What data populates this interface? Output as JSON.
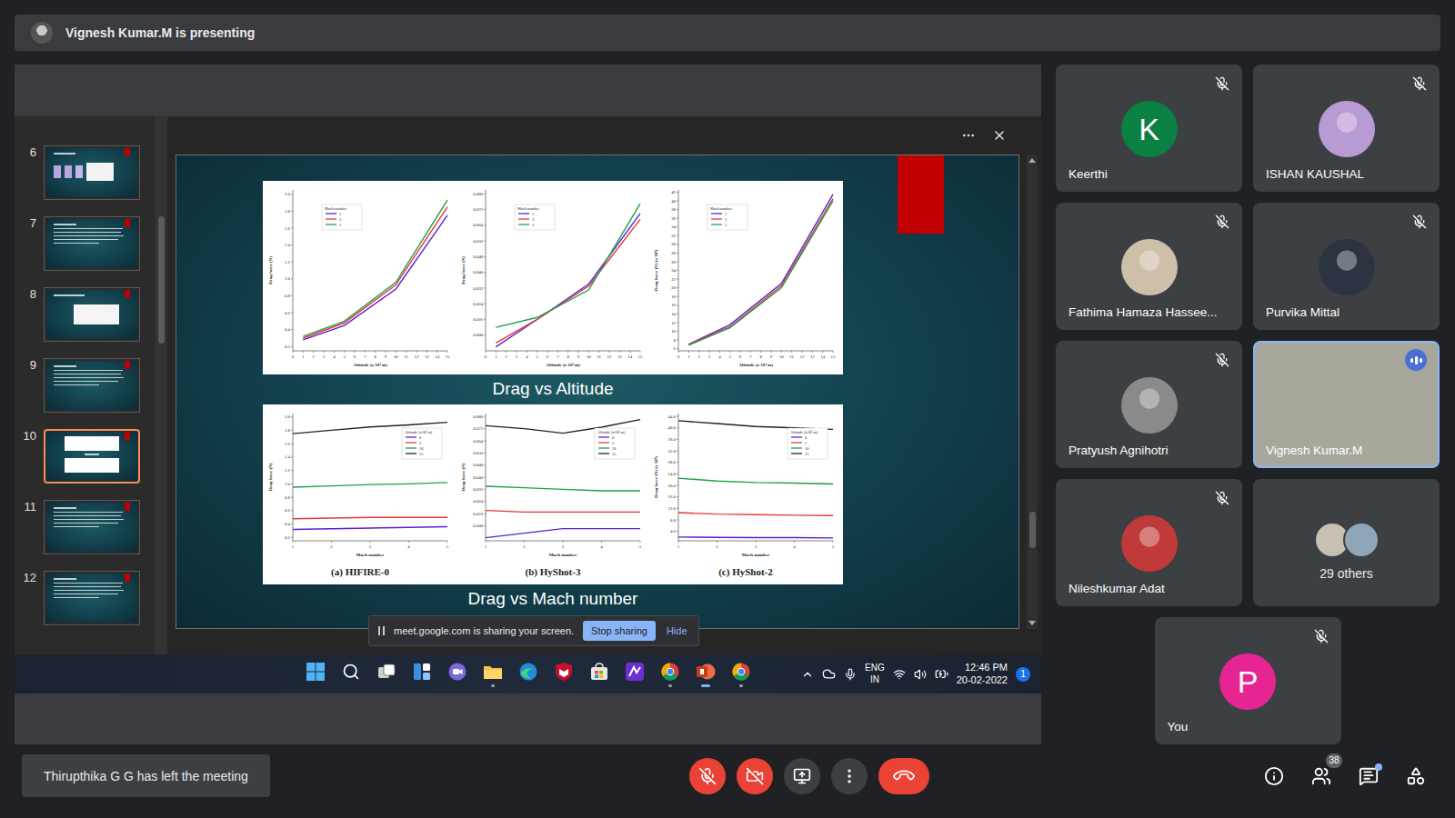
{
  "banner": {
    "text": "Vignesh Kumar.M is presenting"
  },
  "presentation": {
    "thumbnails": [
      {
        "number": "6",
        "selected": false,
        "kind": "images"
      },
      {
        "number": "7",
        "selected": false,
        "kind": "text"
      },
      {
        "number": "8",
        "selected": false,
        "kind": "table"
      },
      {
        "number": "9",
        "selected": false,
        "kind": "text"
      },
      {
        "number": "10",
        "selected": true,
        "kind": "charts"
      },
      {
        "number": "11",
        "selected": false,
        "kind": "text"
      },
      {
        "number": "12",
        "selected": false,
        "kind": "text"
      }
    ],
    "slide": {
      "sections": [
        {
          "title": "Drag vs Altitude",
          "charts": [
            {
              "caption": "",
              "y_label": "Drag force (N)",
              "x_label": "Altitude (x 10³ m)",
              "legend_title": "Mach number",
              "x_ticks": [
                "0",
                "1",
                "2",
                "3",
                "4",
                "5",
                "6",
                "7",
                "8",
                "9",
                "10",
                "11",
                "12",
                "13",
                "14",
                "15"
              ],
              "y_ticks": [
                "0.2",
                "0.4",
                "0.6",
                "0.8",
                "1.0",
                "1.2",
                "1.4",
                "1.6",
                "1.8",
                "2.0"
              ],
              "x": [
                1,
                5,
                10,
                15
              ],
              "series": [
                {
                  "name": "1",
                  "color": "#5b1fd6",
                  "values": [
                    0.28,
                    0.45,
                    0.88,
                    1.75
                  ]
                },
                {
                  "name": "3",
                  "color": "#e53935",
                  "values": [
                    0.3,
                    0.48,
                    0.93,
                    1.85
                  ]
                },
                {
                  "name": "5",
                  "color": "#1e9e4a",
                  "values": [
                    0.32,
                    0.5,
                    0.96,
                    1.93
                  ]
                }
              ]
            },
            {
              "caption": "",
              "y_label": "Drag force (N)",
              "x_label": "Altitude (x 10³ m)",
              "legend_title": "Mach number",
              "x_ticks": [
                "0",
                "1",
                "2",
                "3",
                "4",
                "5",
                "6",
                "7",
                "8",
                "9",
                "10",
                "11",
                "12",
                "13",
                "14",
                "15"
              ],
              "y_ticks": [
                "0.008",
                "0.016",
                "0.024",
                "0.032",
                "0.040",
                "0.048",
                "0.056",
                "0.064",
                "0.072",
                "0.080"
              ],
              "x": [
                1,
                5,
                10,
                15
              ],
              "series": [
                {
                  "name": "1",
                  "color": "#5b1fd6",
                  "values": [
                    0.002,
                    0.016,
                    0.034,
                    0.07
                  ]
                },
                {
                  "name": "3",
                  "color": "#e53935",
                  "values": [
                    0.004,
                    0.016,
                    0.033,
                    0.067
                  ]
                },
                {
                  "name": "5",
                  "color": "#1e9e4a",
                  "values": [
                    0.012,
                    0.017,
                    0.031,
                    0.075
                  ]
                }
              ]
            },
            {
              "caption": "",
              "y_label": "Drag force (N) (x 10³)",
              "x_label": "Altitude (x 10³ m)",
              "legend_title": "Mach number",
              "x_ticks": [
                "0",
                "1",
                "2",
                "3",
                "4",
                "5",
                "6",
                "7",
                "8",
                "9",
                "10",
                "11",
                "12",
                "13",
                "14",
                "15"
              ],
              "y_ticks": [
                "6",
                "8",
                "10",
                "12",
                "14",
                "16",
                "18",
                "20",
                "22",
                "24",
                "26",
                "28",
                "30",
                "32",
                "34",
                "36",
                "38",
                "40",
                "42"
              ],
              "x": [
                1,
                5,
                10,
                15
              ],
              "series": [
                {
                  "name": "1",
                  "color": "#5b1fd6",
                  "values": [
                    7,
                    11.5,
                    21,
                    41.5
                  ]
                },
                {
                  "name": "3",
                  "color": "#e53935",
                  "values": [
                    7,
                    11,
                    20.5,
                    40.5
                  ]
                },
                {
                  "name": "5",
                  "color": "#1e9e4a",
                  "values": [
                    6.8,
                    10.8,
                    20,
                    40
                  ]
                }
              ]
            }
          ]
        },
        {
          "title": "Drag vs Mach number",
          "charts": [
            {
              "caption": "(a) HIFIRE-0",
              "y_label": "Drag force (N)",
              "x_label": "Mach number",
              "legend_title": "Altitude (x10³ m)",
              "x_ticks": [
                "1",
                "2",
                "3",
                "4",
                "5"
              ],
              "y_ticks": [
                "0.2",
                "0.4",
                "0.6",
                "0.8",
                "1.0",
                "1.2",
                "1.4",
                "1.6",
                "1.8",
                "2.0"
              ],
              "x": [
                1,
                2,
                3,
                4,
                5
              ],
              "series": [
                {
                  "name": "0",
                  "color": "#5b1fd6",
                  "values": [
                    0.32,
                    0.33,
                    0.34,
                    0.35,
                    0.36
                  ]
                },
                {
                  "name": "5",
                  "color": "#e53935",
                  "values": [
                    0.48,
                    0.49,
                    0.5,
                    0.5,
                    0.5
                  ]
                },
                {
                  "name": "10",
                  "color": "#1e9e4a",
                  "values": [
                    0.95,
                    0.97,
                    0.99,
                    1.0,
                    1.02
                  ]
                },
                {
                  "name": "15",
                  "color": "#222222",
                  "values": [
                    1.75,
                    1.8,
                    1.85,
                    1.88,
                    1.92
                  ]
                }
              ]
            },
            {
              "caption": "(b) HyShot-3",
              "y_label": "Drag force (N)",
              "x_label": "Mach number",
              "legend_title": "Altitude (x10³ m)",
              "x_ticks": [
                "1",
                "2",
                "3",
                "4",
                "5"
              ],
              "y_ticks": [
                "0.008",
                "0.016",
                "0.024",
                "0.032",
                "0.040",
                "0.048",
                "0.056",
                "0.064",
                "0.072",
                "0.080"
              ],
              "x": [
                1,
                2,
                3,
                4,
                5
              ],
              "series": [
                {
                  "name": "0",
                  "color": "#5b1fd6",
                  "values": [
                    0.0,
                    0.003,
                    0.006,
                    0.006,
                    0.006
                  ]
                },
                {
                  "name": "5",
                  "color": "#e53935",
                  "values": [
                    0.018,
                    0.017,
                    0.017,
                    0.017,
                    0.017
                  ]
                },
                {
                  "name": "10",
                  "color": "#1e9e4a",
                  "values": [
                    0.034,
                    0.033,
                    0.032,
                    0.031,
                    0.031
                  ]
                },
                {
                  "name": "15",
                  "color": "#222222",
                  "values": [
                    0.074,
                    0.072,
                    0.069,
                    0.073,
                    0.078
                  ]
                }
              ]
            },
            {
              "caption": "(c) HyShot-2",
              "y_label": "Drag force (N) (x 10³)",
              "x_label": "Mach number",
              "legend_title": "Altitude (x10³ m)",
              "x_ticks": [
                "1",
                "2",
                "3",
                "4",
                "5"
              ],
              "y_ticks": [
                "4.0",
                "8.0",
                "12.0",
                "16.0",
                "20.0",
                "24.0",
                "28.0",
                "32.0",
                "36.0",
                "40.0",
                "44.0"
              ],
              "x": [
                1,
                2,
                3,
                4,
                5
              ],
              "series": [
                {
                  "name": "0",
                  "color": "#5b1fd6",
                  "values": [
                    2.0,
                    1.9,
                    1.8,
                    1.8,
                    1.7
                  ]
                },
                {
                  "name": "5",
                  "color": "#e53935",
                  "values": [
                    10.5,
                    10.0,
                    9.8,
                    9.6,
                    9.5
                  ]
                },
                {
                  "name": "10",
                  "color": "#1e9e4a",
                  "values": [
                    22.5,
                    21.5,
                    21.0,
                    20.8,
                    20.5
                  ]
                },
                {
                  "name": "15",
                  "color": "#222222",
                  "values": [
                    42.5,
                    41.5,
                    40.5,
                    40.0,
                    39.5
                  ]
                }
              ]
            }
          ]
        }
      ]
    }
  },
  "share_bar": {
    "message": "meet.google.com is sharing your screen.",
    "stop": "Stop sharing",
    "hide": "Hide"
  },
  "taskbar": {
    "apps": [
      {
        "running": false,
        "active": false
      },
      {
        "running": false,
        "active": false
      },
      {
        "running": false,
        "active": false
      },
      {
        "running": false,
        "active": false
      },
      {
        "running": false,
        "active": false
      },
      {
        "running": true,
        "active": false
      },
      {
        "running": false,
        "active": false
      },
      {
        "running": false,
        "active": false
      },
      {
        "running": false,
        "active": false
      },
      {
        "running": false,
        "active": false
      },
      {
        "running": true,
        "active": false
      },
      {
        "running": true,
        "active": true
      },
      {
        "running": true,
        "active": false
      }
    ],
    "language": "ENG",
    "region": "IN",
    "time": "12:46 PM",
    "date": "20-02-2022",
    "notifications": "1"
  },
  "participants": [
    {
      "name": "Keerthi",
      "kind": "letter",
      "initial": "K",
      "color": "#0b8043",
      "muted": true,
      "speaking": false
    },
    {
      "name": "ISHAN KAUSHAL",
      "kind": "photo",
      "initial": "",
      "color": "#b89ad4",
      "muted": true,
      "speaking": false
    },
    {
      "name": "Fathima Hamaza Hassee...",
      "kind": "photo",
      "initial": "",
      "color": "#cdbfa8",
      "muted": true,
      "speaking": false
    },
    {
      "name": "Purvika Mittal",
      "kind": "photo",
      "initial": "",
      "color": "#2b3440",
      "muted": true,
      "speaking": false
    },
    {
      "name": "Pratyush Agnihotri",
      "kind": "photo",
      "initial": "",
      "color": "#8a8a8a",
      "muted": true,
      "speaking": false
    },
    {
      "name": "Vignesh Kumar.M",
      "kind": "video",
      "initial": "",
      "color": "#a8a79c",
      "muted": false,
      "speaking": true
    },
    {
      "name": "Nileshkumar Adat",
      "kind": "photo",
      "initial": "",
      "color": "#c03a3a",
      "muted": true,
      "speaking": false
    }
  ],
  "others": {
    "label": "29 others",
    "avatars": [
      {
        "color": "#c8c0b0"
      },
      {
        "color": "#8fa6b8"
      }
    ]
  },
  "self": {
    "name": "You",
    "initial": "P",
    "color": "#e52592",
    "muted": true
  },
  "toast": "Thirupthika G G has left the meeting",
  "controls": {
    "mic_on": false,
    "camera_on": false
  },
  "side_controls": {
    "people_count": "38",
    "chat_unread": true
  }
}
